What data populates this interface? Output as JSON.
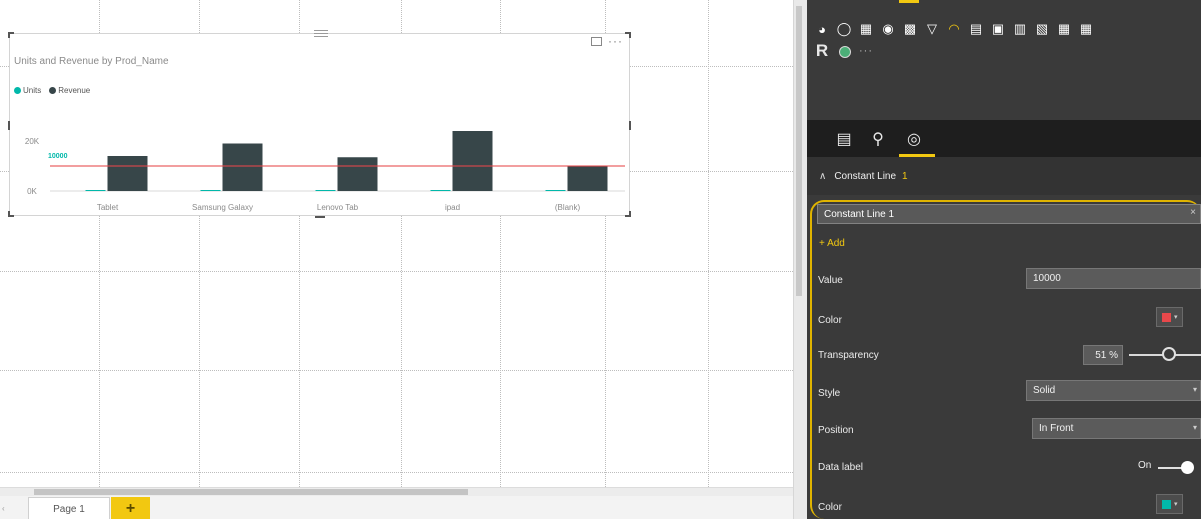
{
  "report": {
    "page_tab_label": "Page 1",
    "add_page_label": "+"
  },
  "visual": {
    "title": "Units and Revenue by Prod_Name",
    "more_options": "···"
  },
  "chart_data": {
    "type": "bar",
    "title": "Units and Revenue by Prod_Name",
    "categories": [
      "Tablet",
      "Samsung Galaxy",
      "Lenovo Tab",
      "ipad",
      "(Blank)"
    ],
    "series": [
      {
        "name": "Units",
        "values": [
          150,
          100,
          100,
          80,
          100
        ],
        "color": "#01b8aa"
      },
      {
        "name": "Revenue",
        "values": [
          14000,
          19000,
          13500,
          24000,
          10000
        ],
        "color": "#374649"
      }
    ],
    "y_ticks": [
      "0K",
      "20K"
    ],
    "ylim": [
      0,
      30000
    ],
    "constant_line": {
      "value": 10000,
      "label": "10000",
      "color": "#e8484b",
      "label_color": "#01b8aa"
    },
    "legend_position": "top-left",
    "grid": false
  },
  "panel": {
    "tabs": [
      "fields",
      "format",
      "analytics"
    ],
    "section_title": "Constant Line",
    "section_count": "1",
    "line_name": "Constant Line 1",
    "add_label": "+ Add",
    "value_label": "Value",
    "value": "10000",
    "color_label": "Color",
    "line_color": "#e8484b",
    "transparency_label": "Transparency",
    "transparency_value": "51 %",
    "transparency_level": 51,
    "style_label": "Style",
    "style_value": "Solid",
    "position_label": "Position",
    "position_value": "In Front",
    "data_label_label": "Data label",
    "data_label_state": "On",
    "label_color_label": "Color",
    "label_color": "#01b8aa"
  },
  "vis_icons": [
    "pie-chart",
    "donut-chart",
    "treemap",
    "map",
    "filled-map",
    "funnel",
    "gauge",
    "multi-row-card",
    "card",
    "kpi",
    "slicer",
    "table",
    "matrix",
    "r-visual",
    "globe",
    "more"
  ]
}
